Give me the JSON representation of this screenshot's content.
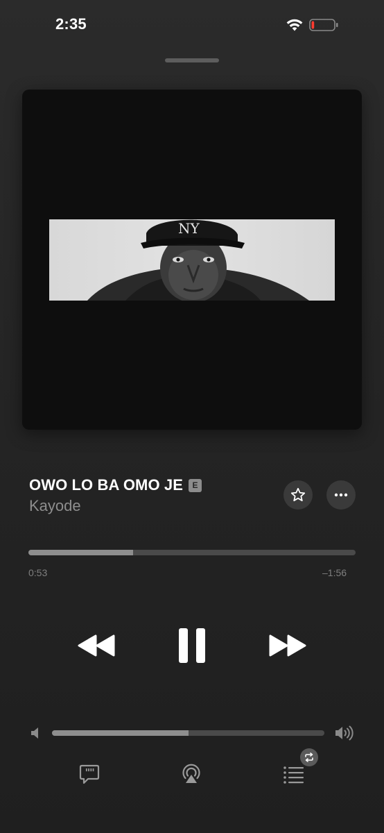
{
  "status_bar": {
    "time": "2:35",
    "wifi_icon": "wifi-icon",
    "battery_icon": "battery-low-icon",
    "battery_level": 0.12,
    "battery_color": "#ff3b30"
  },
  "now_playing": {
    "artwork": "album-artwork",
    "title": "OWO LO BA OMO JE",
    "explicit_badge": "E",
    "artist": "Kayode",
    "actions": {
      "favorite_icon": "star-icon",
      "more_icon": "ellipsis-icon"
    }
  },
  "progress": {
    "elapsed": "0:53",
    "remaining": "–1:56",
    "fraction": 0.32
  },
  "controls": {
    "previous_icon": "rewind-icon",
    "play_pause_icon": "pause-icon",
    "next_icon": "fast-forward-icon"
  },
  "volume": {
    "low_icon": "speaker-low-icon",
    "high_icon": "speaker-high-icon",
    "fraction": 0.5
  },
  "toolbar": {
    "lyrics_icon": "lyrics-icon",
    "airplay_icon": "airplay-icon",
    "queue_icon": "queue-icon",
    "repeat_icon": "repeat-icon"
  },
  "colors": {
    "background": "#242424",
    "accent_fill": "#8e8e8e",
    "track": "#4a4a4a",
    "secondary_text": "#8e8e8e"
  }
}
